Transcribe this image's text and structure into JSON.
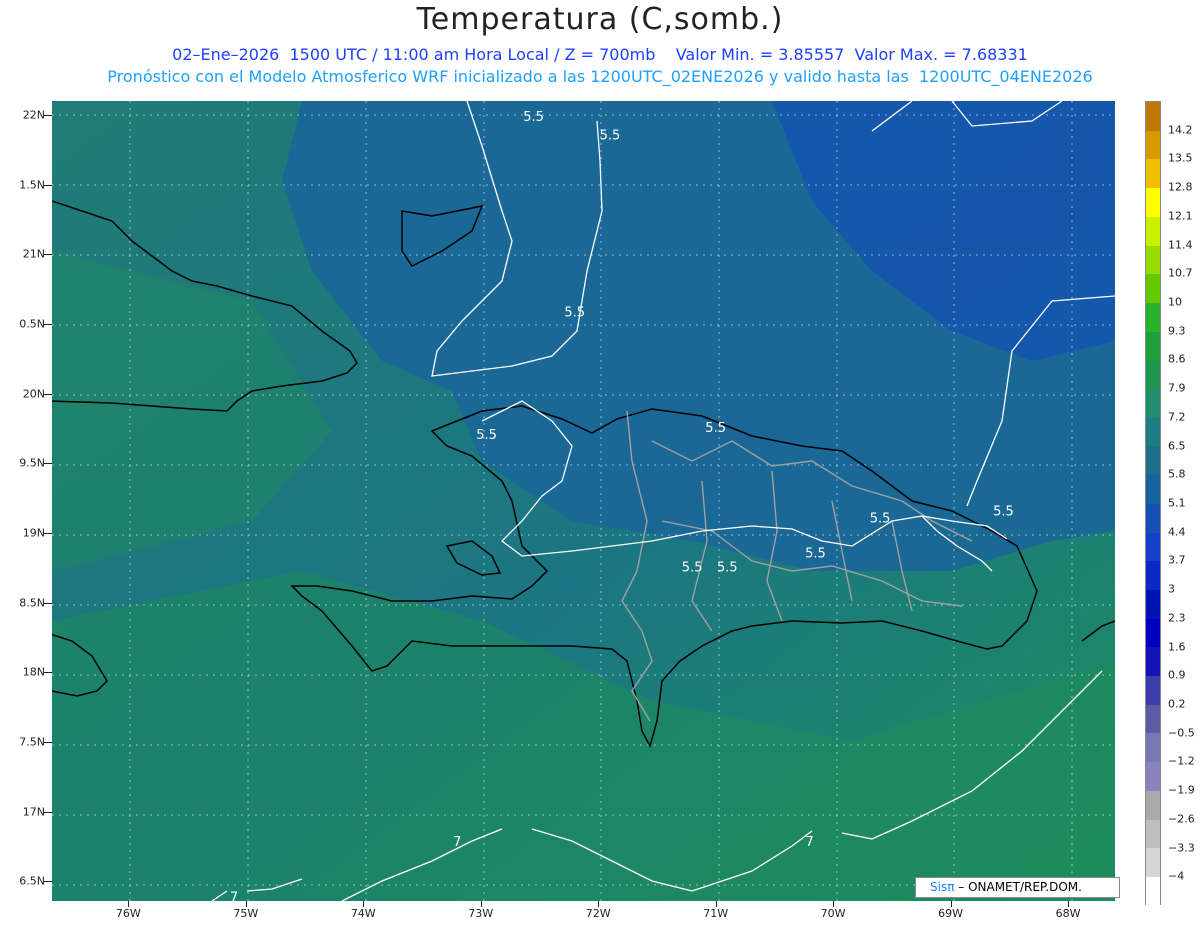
{
  "title": "Temperatura (C,somb.)",
  "subtitle_line1": "02–Ene–2026  1500 UTC / 11:00 am Hora Local / Z = 700mb    Valor Min. = 3.85557  Valor Max. = 7.68331",
  "subtitle_line2": "Pronóstico con el Modelo Atmosferico WRF inicializado a las 1200UTC_02ENE2026 y valido hasta las  1200UTC_04ENE2026",
  "credit": {
    "brand": "Sisπ",
    "text": " – ONAMET/REP.DOM."
  },
  "map_extent": {
    "lon_min": -76.65,
    "lon_max": -67.6,
    "lat_min": 16.36,
    "lat_max": 22.1
  },
  "lat_axis": [
    "22N",
    "1.5N",
    "21N",
    "0.5N",
    "20N",
    "9.5N",
    "19N",
    "8.5N",
    "18N",
    "7.5N",
    "17N",
    "6.5N"
  ],
  "lat_values": [
    22,
    21.5,
    21,
    20.5,
    20,
    19.5,
    19,
    18.5,
    18,
    17.5,
    17,
    16.5
  ],
  "lon_axis": [
    "76W",
    "75W",
    "74W",
    "73W",
    "72W",
    "71W",
    "70W",
    "69W",
    "68W"
  ],
  "lon_values": [
    -76,
    -75,
    -74,
    -73,
    -72,
    -71,
    -70,
    -69,
    -68
  ],
  "colorbar": {
    "labels": [
      "14.2",
      "13.5",
      "12.8",
      "12.1",
      "11.4",
      "10.7",
      "10",
      "9.3",
      "8.6",
      "7.9",
      "7.2",
      "6.5",
      "5.8",
      "5.1",
      "4.4",
      "3.7",
      "3",
      "2.3",
      "1.6",
      "0.9",
      "0.2",
      "−0.5",
      "−1.2",
      "−1.9",
      "−2.6",
      "−3.3",
      "−4"
    ],
    "colors": [
      "#c07800",
      "#d89a00",
      "#f0c000",
      "#ffff00",
      "#c8f000",
      "#96dc00",
      "#64c800",
      "#28b428",
      "#1ea03c",
      "#1e9650",
      "#218c6e",
      "#1e7c82",
      "#1a6f8c",
      "#1464a0",
      "#1450b4",
      "#1440c8",
      "#0a28c8",
      "#0014b4",
      "#0000be",
      "#1414b4",
      "#3c3caa",
      "#5a5aa5",
      "#7878b4",
      "#8c82be",
      "#aaaaaa",
      "#bebebe",
      "#d6d6d6",
      "#ffffff"
    ]
  },
  "contours": [
    {
      "label": "5.5",
      "lon": -72.55,
      "lat": 21.98
    },
    {
      "label": "5.5",
      "lon": -71.9,
      "lat": 21.85
    },
    {
      "label": "5.5",
      "lon": -72.2,
      "lat": 20.58
    },
    {
      "label": "5.5",
      "lon": -72.95,
      "lat": 19.7
    },
    {
      "label": "5.5",
      "lon": -71.0,
      "lat": 19.75
    },
    {
      "label": "5.5",
      "lon": -69.6,
      "lat": 19.1
    },
    {
      "label": "5.5",
      "lon": -68.55,
      "lat": 19.15
    },
    {
      "label": "5.5",
      "lon": -70.15,
      "lat": 18.85
    },
    {
      "label": "5.5",
      "lon": -71.2,
      "lat": 18.75
    },
    {
      "label": "5.5",
      "lon": -70.9,
      "lat": 18.75
    },
    {
      "label": "7",
      "lon": -73.2,
      "lat": 16.78
    },
    {
      "label": "7",
      "lon": -70.2,
      "lat": 16.78
    },
    {
      "label": "7",
      "lon": -75.1,
      "lat": 16.38
    }
  ]
}
